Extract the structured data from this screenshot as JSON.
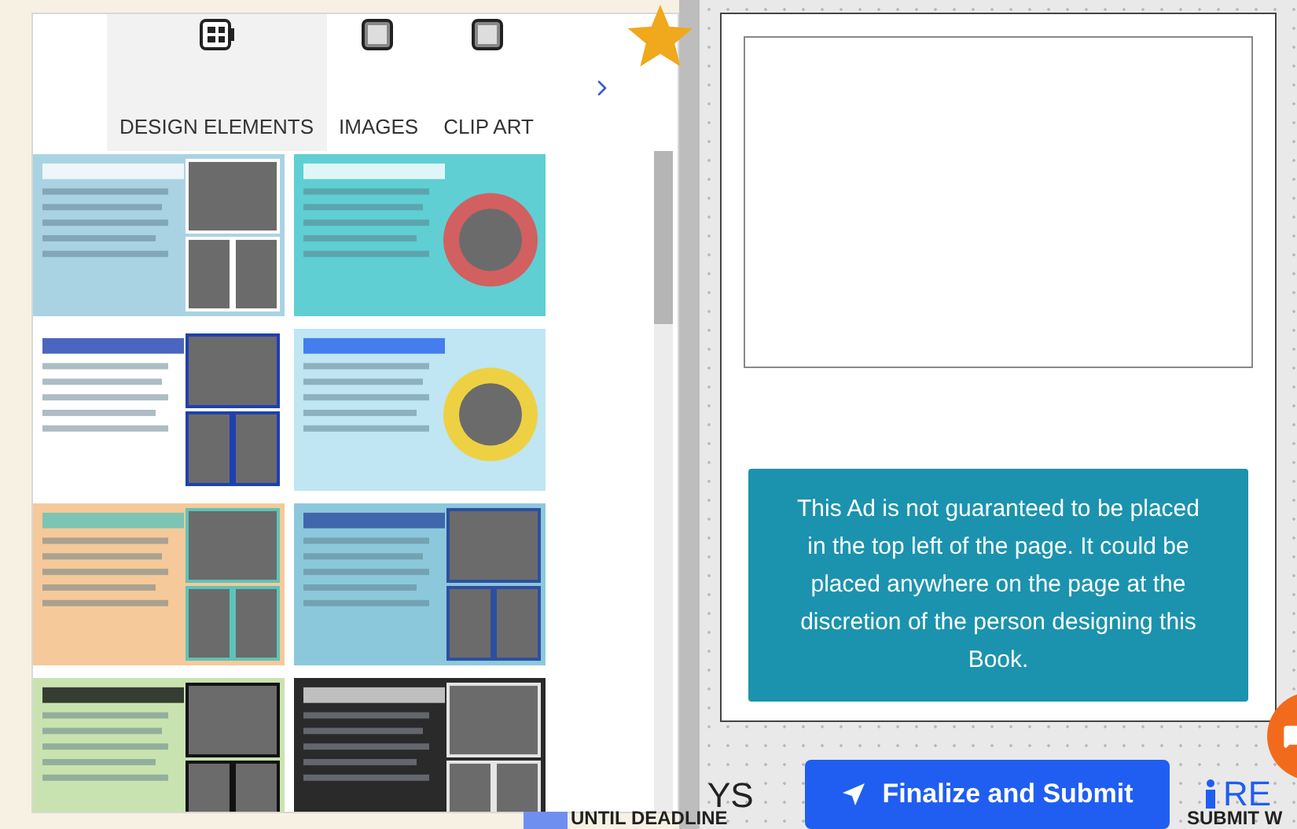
{
  "tabs": [
    {
      "label": "DESIGN ELEMENTS",
      "selected": true
    },
    {
      "label": "IMAGES",
      "selected": false
    },
    {
      "label": "CLIP ART",
      "selected": false
    }
  ],
  "notice": "This Ad is not guaranteed to be placed in the top left of the page. It could be placed anywhere on the page at the discretion of the person designing this Book.",
  "footer": {
    "days_label": "YS",
    "deadline_label": "UNTIL DEADLINE",
    "submit_button": "Finalize and Submit",
    "info_link": "RE",
    "info_caption": "SUBMIT W"
  }
}
